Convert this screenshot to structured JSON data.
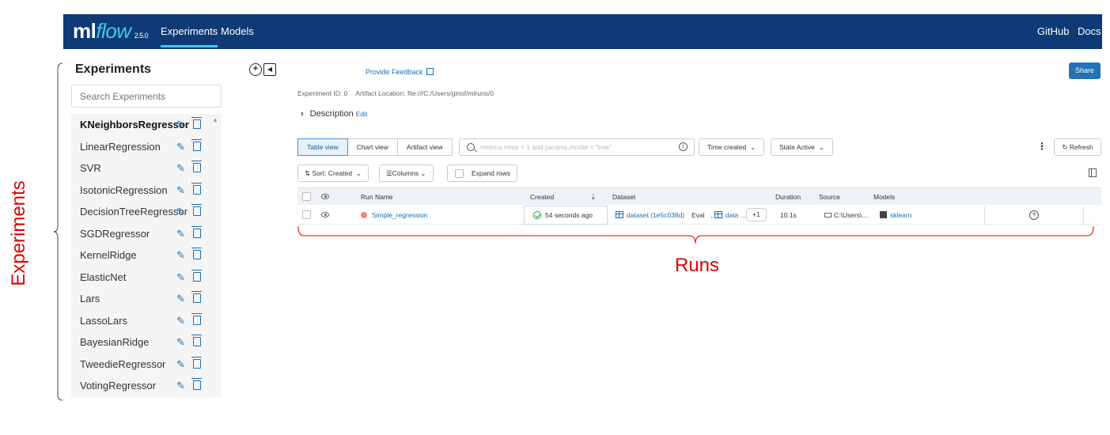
{
  "header": {
    "logo_ml": "ml",
    "logo_flow": "flow",
    "version": "2.5.0",
    "nav": {
      "experiments": "Experiments",
      "models": "Models",
      "github": "GitHub",
      "docs": "Docs"
    }
  },
  "annotations": {
    "experiments_label": "Experiments",
    "runs_label": "Runs",
    "color": "#e00000"
  },
  "sidebar": {
    "title": "Experiments",
    "add_icon": "plus-circle-icon",
    "collapse_icon": "collapse-sidebar-icon",
    "search_placeholder": "Search Experiments",
    "items": [
      {
        "label": "KNeighborsRegressor",
        "active": true
      },
      {
        "label": "LinearRegression"
      },
      {
        "label": "SVR"
      },
      {
        "label": "IsotonicRegression"
      },
      {
        "label": "DecisionTreeRegressor"
      },
      {
        "label": "SGDRegressor"
      },
      {
        "label": "KernelRidge"
      },
      {
        "label": "ElasticNet"
      },
      {
        "label": "Lars"
      },
      {
        "label": "LassoLars"
      },
      {
        "label": "BayesianRidge"
      },
      {
        "label": "TweedieRegressor"
      },
      {
        "label": "VotingRegressor"
      }
    ]
  },
  "main": {
    "feedback": "Provide Feedback",
    "share": "Share",
    "experiment_id": "Experiment ID: 0",
    "artifact_location": "Artifact Location: file:///C:/Users/ginof/mlruns/0",
    "description": "Description",
    "description_edit": "Edit",
    "views": [
      "Table view",
      "Chart view",
      "Artifact view"
    ],
    "active_view": "Table view",
    "filter_placeholder": "metrics.rmse < 1 and params.model = \"tree\"",
    "time_created": "Time created",
    "state": "State Active",
    "refresh": "Refresh",
    "sort": "Sort: Created",
    "columns": "Columns",
    "expand_rows": "Expand rows"
  },
  "table": {
    "headers": {
      "run_name": "Run Name",
      "created": "Created",
      "dataset": "Dataset",
      "duration": "Duration",
      "source": "Source",
      "models": "Models"
    },
    "rows": [
      {
        "run_name": "Simple_regression",
        "status_color": "#f2867f",
        "created": "54 seconds ago",
        "dataset_1": "dataset (1e5c038d)",
        "dataset_1_tag": "Eval",
        "dataset_2": "data ...",
        "dataset_more": "+1",
        "duration": "10.1s",
        "source": "C:\\Users\\...",
        "model": "sklearn"
      }
    ]
  },
  "colors": {
    "header_bg": "#0e3b75",
    "accent": "#43c9ed",
    "link": "#1a6fb5",
    "primary_button": "#2272b4"
  }
}
